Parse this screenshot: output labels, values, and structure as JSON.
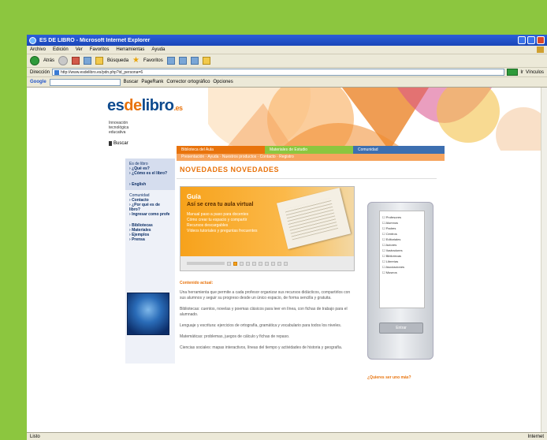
{
  "window": {
    "title": "ES DE LIBRO - Microsoft Internet Explorer"
  },
  "menu": [
    "Archivo",
    "Edición",
    "Ver",
    "Favoritos",
    "Herramientas",
    "Ayuda"
  ],
  "toolbar": {
    "back_label": "Atrás",
    "search_label": "Búsqueda",
    "favorites_label": "Favoritos"
  },
  "address": {
    "label": "Dirección",
    "url": "http://www.esdelibro.es/pdn.php?id_persona=6",
    "go_label": "Ir",
    "links_label": "Vínculos"
  },
  "google_bar": {
    "logo": "Google",
    "search_label": "Buscar",
    "pagerank_label": "PageRank",
    "spell_label": "Corrector ortográfico",
    "options_label": "Opciones"
  },
  "site": {
    "logo_es": "es",
    "logo_de": "de",
    "logo_libro": "libro",
    "logo_dot": ".es",
    "tagline": [
      "Innovación",
      "tecnológica",
      "educativa"
    ],
    "search_label": "Buscar"
  },
  "nav": {
    "tabs": [
      "Biblioteca del Aula",
      "Materiales de Estudio",
      "Comunidad"
    ],
    "subnav": "Presentación · Ayuda · Nuestros productos · Contacto · Registro"
  },
  "left_nav": {
    "block1": [
      "Es de libro",
      "¿Qué es?",
      "¿Cómo es el libro?",
      "English"
    ],
    "block2": [
      "Comunidad",
      "Contacto",
      "¿Por qué es de libro?",
      "Ingresar como profe"
    ],
    "block3": [
      "Bibliotecas",
      "Materiales",
      "Ejemplos",
      "Prensa"
    ]
  },
  "main": {
    "title": "NOVEDADES NOVEDADES",
    "promo": {
      "kicker": "Guía",
      "headline": "Así se crea tu aula virtual",
      "lines": [
        "Manual paso a paso para docentes",
        "Cómo crear tu espacio y compartir",
        "Recursos descargables",
        "Vídeos tutoriales y preguntas frecuentes"
      ]
    },
    "section_label": "Contenido actual:",
    "paragraphs": [
      "Una herramienta que permite a cada profesor organizar sus recursos didácticos, compartirlos con sus alumnos y seguir su progreso desde un único espacio, de forma sencilla y gratuita.",
      "Bibliotecas: cuentos, novelas y poemas clásicos para leer en línea, con fichas de trabajo para el alumnado.",
      "Lenguaje y escritura: ejercicios de ortografía, gramática y vocabulario para todos los niveles.",
      "Matemáticas: problemas, juegos de cálculo y fichas de repaso.",
      "Ciencias sociales: mapas interactivos, líneas del tiempo y actividades de historia y geografía."
    ]
  },
  "right_panel": {
    "items": [
      "Profesores",
      "Alumnos",
      "Padres",
      "Centros",
      "Editoriales",
      "Autores",
      "Ilustradores",
      "Bibliotecas",
      "Librerías",
      "Asociaciones",
      "Museos"
    ],
    "button": "Entrar",
    "link": "¿Quieres ser uno más?"
  },
  "status": {
    "left": "Listo",
    "right": "Internet"
  }
}
